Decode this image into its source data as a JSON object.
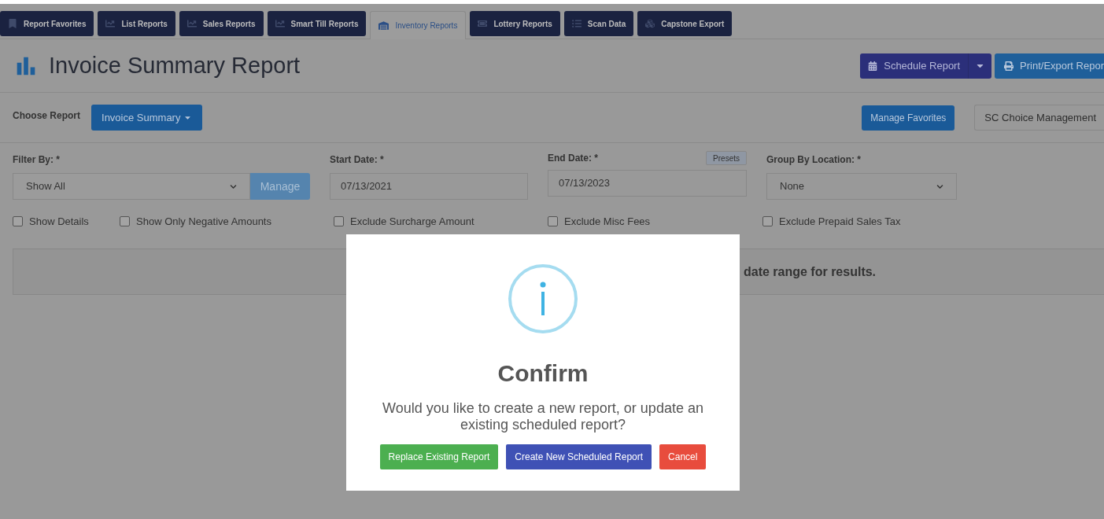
{
  "tabs": [
    {
      "label": "Report Favorites",
      "selected": false
    },
    {
      "label": "List Reports",
      "selected": false
    },
    {
      "label": "Sales Reports",
      "selected": false
    },
    {
      "label": "Smart Till Reports",
      "selected": false
    },
    {
      "label": "Inventory Reports",
      "selected": true
    },
    {
      "label": "Lottery Reports",
      "selected": false
    },
    {
      "label": "Scan Data",
      "selected": false
    },
    {
      "label": "Capstone Export",
      "selected": false
    }
  ],
  "header": {
    "title": "Invoice Summary Report",
    "schedule_button": "Schedule Report",
    "print_button": "Print/Export Repor"
  },
  "choose": {
    "label": "Choose Report",
    "report_button": "Invoice Summary",
    "manage_favorites": "Manage Favorites",
    "location_button": "SC Choice Management"
  },
  "filters": {
    "filter_by": {
      "label": "Filter By: *",
      "value": "Show All",
      "manage": "Manage"
    },
    "start_date": {
      "label": "Start Date: *",
      "value": "07/13/2021"
    },
    "end_date": {
      "label": "End Date: *",
      "value": "07/13/2023",
      "presets": "Presets"
    },
    "group_by": {
      "label": "Group By Location: *",
      "value": "None"
    }
  },
  "checkboxes": [
    {
      "label": "Show Details",
      "checked": false
    },
    {
      "label": "Show Only Negative Amounts",
      "checked": false
    },
    {
      "label": "Exclude Surcharge Amount",
      "checked": false
    },
    {
      "label": "Exclude Misc Fees",
      "checked": false
    },
    {
      "label": "Exclude Prepaid Sales Tax",
      "checked": false
    }
  ],
  "notice": "date range for results.",
  "dialog": {
    "title": "Confirm",
    "message": "Would you like to create a new report, or update an existing scheduled report?",
    "buttons": [
      {
        "label": "Replace Existing Report",
        "kind": "success"
      },
      {
        "label": "Create New Scheduled Report",
        "kind": "primary"
      },
      {
        "label": "Cancel",
        "kind": "danger"
      }
    ]
  }
}
